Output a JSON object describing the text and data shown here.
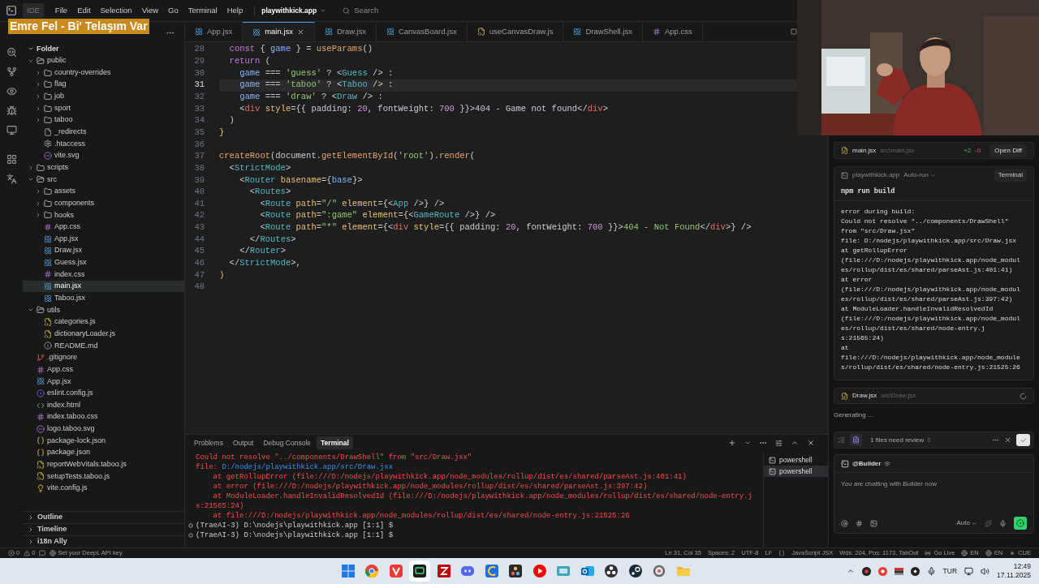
{
  "title_bar": {
    "app_label": "IDE",
    "menu": [
      "File",
      "Edit",
      "Selection",
      "View",
      "Go",
      "Terminal",
      "Help"
    ],
    "project": "playwithkick.app",
    "search": "Search"
  },
  "overlay_banner": "Emre Fel - Bi' Telaşım Var",
  "explorer": {
    "section": "Folder",
    "expanded": true,
    "tree": [
      {
        "label": "public",
        "kind": "folder",
        "expanded": true,
        "selected": false,
        "children": [
          {
            "label": "country-overrides",
            "kind": "folder",
            "expanded": false,
            "selected": false
          },
          {
            "label": "flag",
            "kind": "folder",
            "expanded": false,
            "selected": false
          },
          {
            "label": "job",
            "kind": "folder",
            "expanded": false,
            "selected": false
          },
          {
            "label": "sport",
            "kind": "folder",
            "expanded": false,
            "selected": false
          },
          {
            "label": "taboo",
            "kind": "folder",
            "expanded": false,
            "selected": false
          },
          {
            "label": "_redirects",
            "kind": "file",
            "selected": false
          },
          {
            "label": ".htaccess",
            "kind": "config",
            "selected": false
          },
          {
            "label": "vite.svg",
            "kind": "svg",
            "selected": false
          }
        ]
      },
      {
        "label": "scripts",
        "kind": "folder",
        "expanded": false,
        "selected": false
      },
      {
        "label": "src",
        "kind": "folder",
        "expanded": true,
        "selected": false,
        "children": [
          {
            "label": "assets",
            "kind": "folder",
            "expanded": false,
            "selected": false
          },
          {
            "label": "components",
            "kind": "folder",
            "expanded": false,
            "selected": false
          },
          {
            "label": "hooks",
            "kind": "folder",
            "expanded": false,
            "selected": false
          },
          {
            "label": "App.css",
            "kind": "css",
            "selected": false
          },
          {
            "label": "App.jsx",
            "kind": "jsx",
            "selected": false
          },
          {
            "label": "Draw.jsx",
            "kind": "jsx",
            "selected": false
          },
          {
            "label": "Guess.jsx",
            "kind": "jsx",
            "selected": false
          },
          {
            "label": "index.css",
            "kind": "css",
            "selected": false
          },
          {
            "label": "main.jsx",
            "kind": "jsx",
            "selected": true
          },
          {
            "label": "Taboo.jsx",
            "kind": "jsx",
            "selected": false
          }
        ]
      },
      {
        "label": "utils",
        "kind": "folder",
        "expanded": true,
        "selected": false,
        "children": [
          {
            "label": "categories.js",
            "kind": "js",
            "selected": false
          },
          {
            "label": "dictionaryLoader.js",
            "kind": "js",
            "selected": false
          },
          {
            "label": "README.md",
            "kind": "md",
            "selected": false
          }
        ]
      },
      {
        "label": ".gitignore",
        "kind": "git",
        "selected": false
      },
      {
        "label": "App.css",
        "kind": "css",
        "selected": false
      },
      {
        "label": "App.jsx",
        "kind": "jsx",
        "selected": false
      },
      {
        "label": "eslint.config.js",
        "kind": "eslint",
        "selected": false
      },
      {
        "label": "index.html",
        "kind": "html",
        "selected": false
      },
      {
        "label": "index.taboo.css",
        "kind": "css",
        "selected": false
      },
      {
        "label": "logo.taboo.svg",
        "kind": "svg",
        "selected": false
      },
      {
        "label": "package-lock.json",
        "kind": "json",
        "selected": false
      },
      {
        "label": "package.json",
        "kind": "json",
        "selected": false
      },
      {
        "label": "reportWebVitals.taboo.js",
        "kind": "js",
        "selected": false
      },
      {
        "label": "setupTests.taboo.js",
        "kind": "js",
        "selected": false
      },
      {
        "label": "vite.config.js",
        "kind": "vite",
        "selected": false
      }
    ],
    "panels": [
      {
        "label": "Outline",
        "expanded": false
      },
      {
        "label": "Timeline",
        "expanded": false
      },
      {
        "label": "i18n Ally",
        "expanded": false
      }
    ]
  },
  "editor": {
    "tabs": [
      {
        "label": "App.jsx",
        "kind": "jsx",
        "selected": false
      },
      {
        "label": "main.jsx",
        "kind": "jsx",
        "selected": true
      },
      {
        "label": "Draw.jsx",
        "kind": "jsx",
        "selected": false
      },
      {
        "label": "CanvasBoard.jsx",
        "kind": "jsx",
        "selected": false
      },
      {
        "label": "useCanvasDraw.js",
        "kind": "js",
        "selected": false
      },
      {
        "label": "DrawShell.jsx",
        "kind": "jsx",
        "selected": false
      },
      {
        "label": "App.css",
        "kind": "css",
        "selected": false
      }
    ],
    "lines": [
      {
        "number": "28",
        "current": false,
        "tokens": [
          {
            "text": "  const",
            "kind": "kw"
          },
          {
            "text": " { ",
            "kind": "plain"
          },
          {
            "text": "game",
            "kind": "var"
          },
          {
            "text": " } = ",
            "kind": "plain"
          },
          {
            "text": "useParams",
            "kind": "fn"
          },
          {
            "text": "()",
            "kind": "plain"
          }
        ]
      },
      {
        "number": "29",
        "current": false,
        "tokens": [
          {
            "text": "  return",
            "kind": "kw"
          },
          {
            "text": " (",
            "kind": "plain"
          }
        ]
      },
      {
        "number": "30",
        "current": false,
        "tokens": [
          {
            "text": "    game",
            "kind": "var"
          },
          {
            "text": " === ",
            "kind": "plain"
          },
          {
            "text": "'guess'",
            "kind": "str"
          },
          {
            "text": " ? <",
            "kind": "plain"
          },
          {
            "text": "Guess",
            "kind": "comp"
          },
          {
            "text": " /> :",
            "kind": "plain"
          }
        ]
      },
      {
        "number": "31",
        "current": true,
        "tokens": [
          {
            "text": "    game",
            "kind": "var"
          },
          {
            "text": " === ",
            "kind": "plain"
          },
          {
            "text": "'taboo'",
            "kind": "str"
          },
          {
            "text": " ? <",
            "kind": "plain"
          },
          {
            "text": "Taboo",
            "kind": "comp"
          },
          {
            "text": " /> :",
            "kind": "plain"
          }
        ]
      },
      {
        "number": "32",
        "current": false,
        "tokens": [
          {
            "text": "    game",
            "kind": "var"
          },
          {
            "text": " === ",
            "kind": "plain"
          },
          {
            "text": "'draw'",
            "kind": "str"
          },
          {
            "text": " ? <",
            "kind": "plain"
          },
          {
            "text": "Draw",
            "kind": "comp"
          },
          {
            "text": " /> :",
            "kind": "plain"
          }
        ]
      },
      {
        "number": "33",
        "current": false,
        "tokens": [
          {
            "text": "    <",
            "kind": "plain"
          },
          {
            "text": "div",
            "kind": "tag"
          },
          {
            "text": " style",
            "kind": "attr"
          },
          {
            "text": "={{ padding: ",
            "kind": "plain"
          },
          {
            "text": "20",
            "kind": "num"
          },
          {
            "text": ", fontWeight: ",
            "kind": "plain"
          },
          {
            "text": "700",
            "kind": "num"
          },
          {
            "text": " }}>404 - Game not found</",
            "kind": "plain"
          },
          {
            "text": "div",
            "kind": "tag"
          },
          {
            "text": ">",
            "kind": "plain"
          }
        ]
      },
      {
        "number": "34",
        "current": false,
        "tokens": [
          {
            "text": "  )",
            "kind": "plain"
          }
        ]
      },
      {
        "number": "35",
        "current": false,
        "tokens": [
          {
            "text": "}",
            "kind": "attr"
          }
        ]
      },
      {
        "number": "36",
        "current": false
      },
      {
        "number": "37",
        "current": false,
        "tokens": [
          {
            "text": "createRoot",
            "kind": "fn"
          },
          {
            "text": "(document.",
            "kind": "plain"
          },
          {
            "text": "getElementById",
            "kind": "fn"
          },
          {
            "text": "(",
            "kind": "plain"
          },
          {
            "text": "'root'",
            "kind": "str"
          },
          {
            "text": ").",
            "kind": "plain"
          },
          {
            "text": "render",
            "kind": "fn"
          },
          {
            "text": "(",
            "kind": "plain"
          }
        ]
      },
      {
        "number": "38",
        "current": false,
        "tokens": [
          {
            "text": "  <",
            "kind": "plain"
          },
          {
            "text": "StrictMode",
            "kind": "comp"
          },
          {
            "text": ">",
            "kind": "plain"
          }
        ]
      },
      {
        "number": "39",
        "current": false,
        "tokens": [
          {
            "text": "    <",
            "kind": "plain"
          },
          {
            "text": "Router",
            "kind": "comp"
          },
          {
            "text": " basename",
            "kind": "attr"
          },
          {
            "text": "={",
            "kind": "plain"
          },
          {
            "text": "base",
            "kind": "var"
          },
          {
            "text": "}>",
            "kind": "plain"
          }
        ]
      },
      {
        "number": "40",
        "current": false,
        "tokens": [
          {
            "text": "      <",
            "kind": "plain"
          },
          {
            "text": "Routes",
            "kind": "comp"
          },
          {
            "text": ">",
            "kind": "plain"
          }
        ]
      },
      {
        "number": "41",
        "current": false,
        "tokens": [
          {
            "text": "        <",
            "kind": "plain"
          },
          {
            "text": "Route",
            "kind": "comp"
          },
          {
            "text": " path",
            "kind": "attr"
          },
          {
            "text": "=",
            "kind": "plain"
          },
          {
            "text": "\"/\"",
            "kind": "str"
          },
          {
            "text": " element",
            "kind": "attr"
          },
          {
            "text": "={<",
            "kind": "plain"
          },
          {
            "text": "App",
            "kind": "comp"
          },
          {
            "text": " />} />",
            "kind": "plain"
          }
        ]
      },
      {
        "number": "42",
        "current": false,
        "tokens": [
          {
            "text": "        <",
            "kind": "plain"
          },
          {
            "text": "Route",
            "kind": "comp"
          },
          {
            "text": " path",
            "kind": "attr"
          },
          {
            "text": "=",
            "kind": "plain"
          },
          {
            "text": "\":game\"",
            "kind": "str"
          },
          {
            "text": " element",
            "kind": "attr"
          },
          {
            "text": "={<",
            "kind": "plain"
          },
          {
            "text": "GameRoute",
            "kind": "comp"
          },
          {
            "text": " />} />",
            "kind": "plain"
          }
        ]
      },
      {
        "number": "43",
        "current": false,
        "tokens": [
          {
            "text": "        <",
            "kind": "plain"
          },
          {
            "text": "Route",
            "kind": "comp"
          },
          {
            "text": " path",
            "kind": "attr"
          },
          {
            "text": "=",
            "kind": "plain"
          },
          {
            "text": "\"*\"",
            "kind": "str"
          },
          {
            "text": " element",
            "kind": "attr"
          },
          {
            "text": "={<",
            "kind": "plain"
          },
          {
            "text": "div",
            "kind": "tag"
          },
          {
            "text": " style",
            "kind": "attr"
          },
          {
            "text": "={{ padding: ",
            "kind": "plain"
          },
          {
            "text": "20",
            "kind": "num"
          },
          {
            "text": ", fontWeight: ",
            "kind": "plain"
          },
          {
            "text": "700",
            "kind": "num"
          },
          {
            "text": " }}>",
            "kind": "plain"
          },
          {
            "text": "404 - Not Found",
            "kind": "str"
          },
          {
            "text": "</",
            "kind": "plain"
          },
          {
            "text": "div",
            "kind": "tag"
          },
          {
            "text": ">} />",
            "kind": "plain"
          }
        ]
      },
      {
        "number": "44",
        "current": false,
        "tokens": [
          {
            "text": "      </",
            "kind": "plain"
          },
          {
            "text": "Routes",
            "kind": "comp"
          },
          {
            "text": ">",
            "kind": "plain"
          }
        ]
      },
      {
        "number": "45",
        "current": false,
        "tokens": [
          {
            "text": "    </",
            "kind": "plain"
          },
          {
            "text": "Router",
            "kind": "comp"
          },
          {
            "text": ">",
            "kind": "plain"
          }
        ]
      },
      {
        "number": "46",
        "current": false,
        "tokens": [
          {
            "text": "  </",
            "kind": "plain"
          },
          {
            "text": "StrictMode",
            "kind": "comp"
          },
          {
            "text": ">,",
            "kind": "plain"
          }
        ]
      },
      {
        "number": "47",
        "current": false,
        "tokens": [
          {
            "text": ")",
            "kind": "attr"
          }
        ]
      },
      {
        "number": "48",
        "current": false
      }
    ]
  },
  "panel": {
    "tabs": [
      {
        "label": "Problems",
        "selected": false
      },
      {
        "label": "Output",
        "selected": false
      },
      {
        "label": "Debug Console",
        "selected": false
      },
      {
        "label": "Terminal",
        "selected": true
      }
    ],
    "terminal_lines": [
      {
        "kind": "output",
        "segments": [
          {
            "text": "Could not resolve \"../components/DrawShell\" from \"src/Draw.jsx\"",
            "kind": "error"
          }
        ]
      },
      {
        "kind": "output",
        "segments": [
          {
            "text": "file: ",
            "kind": "error"
          },
          {
            "text": "D:/nodejs/playwithkick.app/src/Draw.jsx",
            "kind": "path"
          }
        ]
      },
      {
        "kind": "output",
        "segments": [
          {
            "text": "    at getRollupError (file:///D:/nodejs/playwithkick.app/node_modules/rollup/dist/es/shared/parseAst.js:401:41)",
            "kind": "error"
          }
        ]
      },
      {
        "kind": "output",
        "segments": [
          {
            "text": "    at error (file:///D:/nodejs/playwithkick.app/node_modules/rollup/dist/es/shared/parseAst.js:397:42)",
            "kind": "error"
          }
        ]
      },
      {
        "kind": "output",
        "segments": [
          {
            "text": "    at ModuleLoader.handleInvalidResolvedId (file:///D:/nodejs/playwithkick.app/node_modules/rollup/dist/es/shared/node-entry.j",
            "kind": "error"
          }
        ]
      },
      {
        "kind": "output",
        "segments": [
          {
            "text": "s:21565:24)",
            "kind": "error"
          }
        ]
      },
      {
        "kind": "output",
        "segments": [
          {
            "text": "    at file:///D:/nodejs/playwithkick.app/node_modules/rollup/dist/es/shared/node-entry.js:21525:26",
            "kind": "error"
          }
        ]
      },
      {
        "kind": "prompt",
        "segments": [
          {
            "text": "(TraeAI-3) D:\\nodejs\\playwithkick.app [1:1] $",
            "kind": "plain"
          }
        ]
      },
      {
        "kind": "prompt",
        "segments": [
          {
            "text": "(TraeAI-3) D:\\nodejs\\playwithkick.app [1:1] $",
            "kind": "plain"
          }
        ]
      }
    ],
    "terminals": [
      {
        "label": "powershell",
        "selected": false
      },
      {
        "label": "powershell",
        "selected": true
      }
    ]
  },
  "assistant": {
    "changed_file": {
      "name": "main.jsx",
      "path": "src\\main.jsx",
      "added": "+2",
      "removed": "-0",
      "action": "Open Diff"
    },
    "run_card": {
      "project": "playwithkick.app",
      "mode": "Auto-run",
      "button": "Terminal",
      "command": "npm run build",
      "output": [
        "error during build:",
        "Could not resolve \"../components/DrawShell\"",
        "from \"src/Draw.jsx\"",
        "file: D:/nodejs/playwithkick.app/src/Draw.jsx",
        "at getRollupError",
        "(file:///D:/nodejs/playwithkick.app/node_modul",
        "es/rollup/dist/es/shared/parseAst.js:401:41)",
        "at error",
        "(file:///D:/nodejs/playwithkick.app/node_modul",
        "es/rollup/dist/es/shared/parseAst.js:397:42)",
        "at ModuleLoader.handleInvalidResolvedId",
        "(file:///D:/nodejs/playwithkick.app/node_modul",
        "es/rollup/dist/es/shared/node-entry.j",
        "s:21565:24)",
        "at",
        "file:///D:/nodejs/playwithkick.app/node_module",
        "s/rollup/dist/es/shared/node-entry.js:21525:26"
      ]
    },
    "pending_file": {
      "name": "Draw.jsx",
      "path": "src\\Draw.jsx"
    },
    "status": "Generating ...",
    "review": "1 files need review",
    "agent": "@Builder",
    "placeholder": "You are chatting with Builder now",
    "model": "Auto"
  },
  "status_bar": {
    "errors": "0",
    "warnings": "0",
    "deepl": "Set your DeepL API key",
    "right": [
      {
        "kind": "text",
        "text": "Ln 31, Col 35"
      },
      {
        "kind": "text",
        "text": "Spaces: 2"
      },
      {
        "kind": "text",
        "text": "UTF-8"
      },
      {
        "kind": "text",
        "text": "LF"
      },
      {
        "kind": "braces"
      },
      {
        "kind": "text",
        "text": "JavaScript JSX"
      },
      {
        "kind": "text",
        "text": "Wds: 204, Pos: 1173, TabOut"
      },
      {
        "kind": "live",
        "text": "Go Live"
      },
      {
        "kind": "locale",
        "text": "EN"
      },
      {
        "kind": "locale",
        "text": "EN"
      },
      {
        "kind": "cue",
        "text": "CUE"
      }
    ]
  },
  "taskbar": {
    "language": "TUR",
    "time": "12:49",
    "date": "17.11.2025"
  }
}
